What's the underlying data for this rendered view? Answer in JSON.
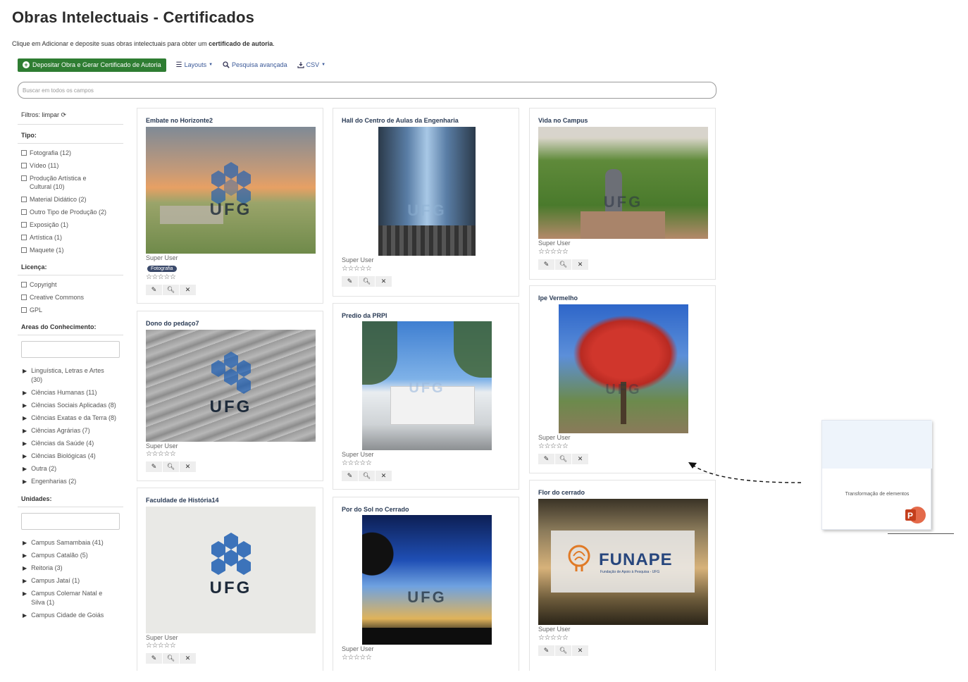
{
  "page": {
    "title": "Obras Intelectuais - Certificados",
    "subtitle_prefix": "Clique em Adicionar e deposite suas obras intelectuais para obter um ",
    "subtitle_bold": "certificado de autoria",
    "subtitle_suffix": "."
  },
  "toolbar": {
    "deposit_label": "Depositar Obra e Gerar Certificado de Autoria",
    "layouts_label": "Layouts",
    "advanced_search_label": "Pesquisa avançada",
    "csv_label": "CSV"
  },
  "search": {
    "placeholder": "Buscar em todos os campos"
  },
  "sidebar": {
    "filters_label": "Filtros: limpar",
    "tipo": {
      "heading": "Tipo:",
      "items": [
        "Fotografia (12)",
        "Vídeo (11)",
        "Produção Artística e Cultural (10)",
        "Material Didático (2)",
        "Outro Tipo de Produção (2)",
        "Exposição (1)",
        "Artística (1)",
        "Maquete (1)"
      ]
    },
    "licenca": {
      "heading": "Licença:",
      "items": [
        "Copyright",
        "Creative Commons",
        "GPL"
      ]
    },
    "areas": {
      "heading": "Areas do Conhecimento:",
      "items": [
        "Linguística, Letras e Artes (30)",
        "Ciências Humanas (11)",
        "Ciências Sociais Aplicadas (8)",
        "Ciências Exatas e da Terra (8)",
        "Ciências Agrárias (7)",
        "Ciências da Saúde (4)",
        "Ciências Biológicas (4)",
        "Outra (2)",
        "Engenharias (2)"
      ]
    },
    "unidades": {
      "heading": "Unidades:",
      "items": [
        "Campus Samambaia (41)",
        "Campus Catalão (5)",
        "Reitoria (3)",
        "Campus Jataí (1)",
        "Campus Colemar Natal e Silva (1)",
        "Campus Cidade de Goiás"
      ]
    }
  },
  "cards": [
    {
      "title": "Embate no Horizonte2",
      "user": "Super User",
      "badge": "Fotografia",
      "stars": "☆☆☆☆☆",
      "watermark": "UFG"
    },
    {
      "title": "Dono do pedaço7",
      "user": "Super User",
      "stars": "☆☆☆☆☆",
      "watermark": "UFG"
    },
    {
      "title": "Faculdade de História14",
      "user": "Super User",
      "stars": "☆☆☆☆☆",
      "watermark": "UFG"
    },
    {
      "title": "Hall do Centro de Aulas da Engenharia",
      "user": "Super User",
      "stars": "☆☆☆☆☆",
      "watermark": "UFG"
    },
    {
      "title": "Predio da PRPI",
      "user": "Super User",
      "stars": "☆☆☆☆☆",
      "watermark": "UFG"
    },
    {
      "title": "Por do Sol no Cerrado",
      "user": "Super User",
      "stars": "☆☆☆☆☆",
      "watermark": "UFG"
    },
    {
      "title": "Vida no Campus",
      "user": "Super User",
      "stars": "☆☆☆☆☆",
      "watermark": "UFG"
    },
    {
      "title": "Ipe Vermelho",
      "user": "Super User",
      "stars": "☆☆☆☆☆",
      "watermark": "UFG"
    },
    {
      "title": "Flor do cerrado",
      "user": "Super User",
      "stars": "☆☆☆☆☆",
      "watermark": "FUNAPE",
      "watermark_sub": "Fundação de Apoio à Pesquisa - UFG"
    }
  ],
  "icons": {
    "edit": "edit-icon",
    "view": "search-icon",
    "delete": "close-icon"
  },
  "ppt_popup": {
    "label": "Transformação de elementos"
  },
  "colors": {
    "primary_button": "#2e7d32",
    "link": "#3b5998",
    "title_text": "#2a3b55"
  }
}
